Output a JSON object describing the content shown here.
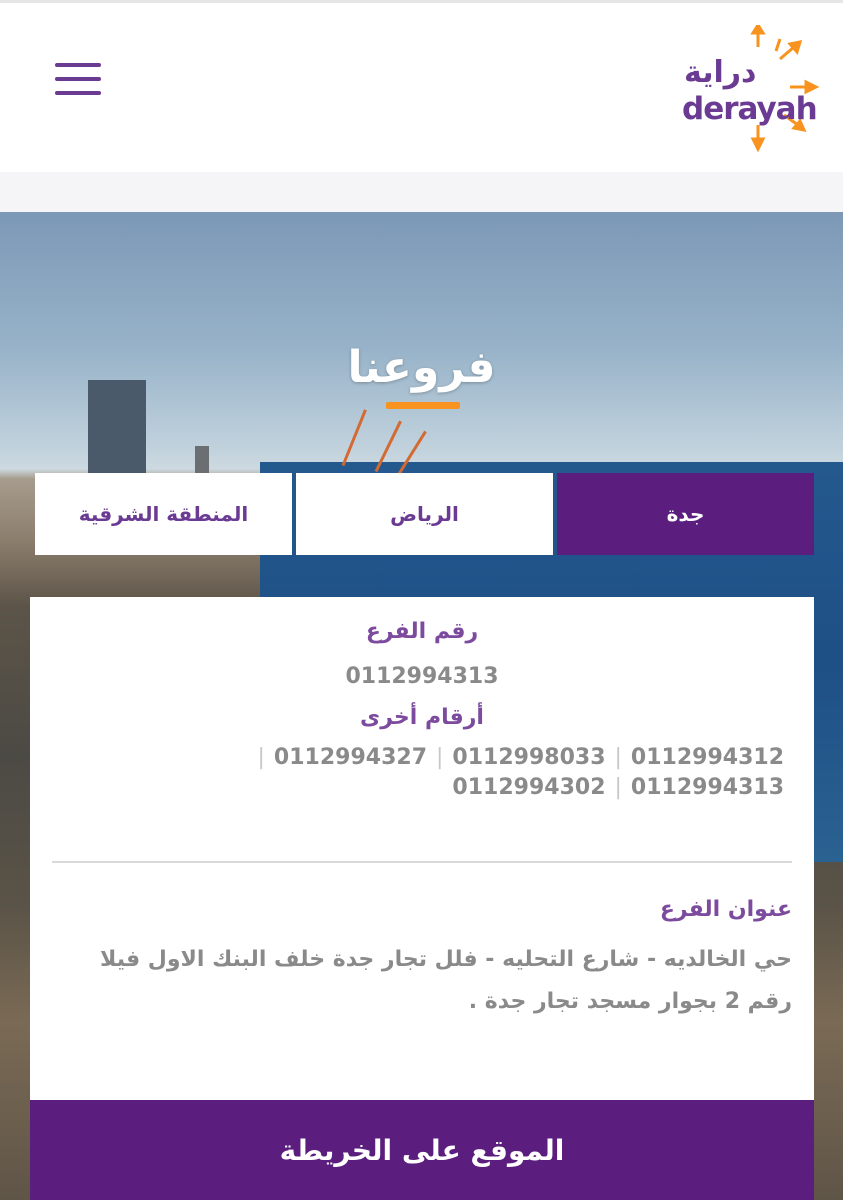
{
  "header": {
    "logo_ar": "دراية",
    "logo_en": "derayah",
    "menu_icon": "hamburger-menu-icon"
  },
  "page": {
    "title": "فروعنا"
  },
  "tabs": [
    {
      "label": "جدة",
      "active": true
    },
    {
      "label": "الرياض",
      "active": false
    },
    {
      "label": "المنطقة الشرقية",
      "active": false
    }
  ],
  "branch": {
    "number_label": "رقم الفرع",
    "number": "0112994313",
    "other_label": "أرقام أخرى",
    "other_numbers": [
      "0112994312",
      "0112998033",
      "0112994327",
      "0112994313",
      "0112994302"
    ],
    "address_label": "عنوان الفرع",
    "address": "حي الخالديه - شارع التحليه - فلل تجار جدة خلف البنك الاول فيلا رقم 2 بجوار مسجد تجار جدة ."
  },
  "map_button": "الموقع على الخريطة",
  "colors": {
    "brand_purple": "#5b1e7e",
    "label_purple": "#7d4b9e",
    "accent_orange": "#f7931e"
  }
}
